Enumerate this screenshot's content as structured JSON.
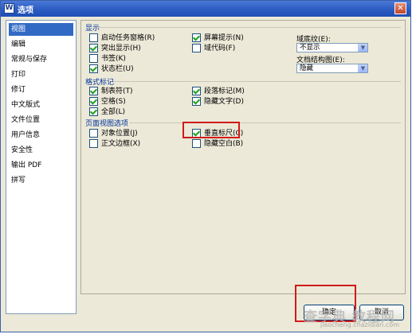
{
  "window": {
    "title": "选项",
    "app_icon_letter": "W",
    "close_glyph": "✕"
  },
  "sidebar": {
    "items": [
      {
        "label": "视图",
        "selected": true
      },
      {
        "label": "编辑"
      },
      {
        "label": "常规与保存"
      },
      {
        "label": "打印"
      },
      {
        "label": "修订"
      },
      {
        "label": "中文版式"
      },
      {
        "label": "文件位置"
      },
      {
        "label": "用户信息"
      },
      {
        "label": "安全性"
      },
      {
        "label": "输出 PDF"
      },
      {
        "label": "拼写"
      }
    ]
  },
  "display": {
    "title": "显示",
    "startup_taskpane": "启动任务窗格(R)",
    "highlight": "突出显示(H)",
    "bookmarks": "书签(K)",
    "statusbar": "状态栏(U)",
    "screentips": "屏幕提示(N)",
    "field_codes": "域代码(F)",
    "field_shading_label": "域底纹(E):",
    "field_shading_value": "不显示",
    "docmap_label": "文档结构图(E):",
    "docmap_value": "隐藏"
  },
  "format_marks": {
    "title": "格式标记",
    "tab_chars": "制表符(T)",
    "spaces": "空格(S)",
    "all": "全部(L)",
    "paragraph_marks": "段落标记(M)",
    "hidden_text": "隐藏文字(D)"
  },
  "page_view": {
    "title": "页面视图选项",
    "object_anchors": "对象位置(J)",
    "text_boundaries": "正文边框(X)",
    "vertical_ruler": "垂直标尺(C)",
    "hide_whitespace": "隐藏空白(B)"
  },
  "buttons": {
    "ok": "确定",
    "cancel": "取消"
  },
  "watermark": {
    "big": "查字典 教程网",
    "small": "jiaocheng.chazidian.com"
  },
  "colors": {
    "title_bar": "#2a59c0",
    "highlight_box": "#d01a1a",
    "selection": "#316ac5"
  }
}
